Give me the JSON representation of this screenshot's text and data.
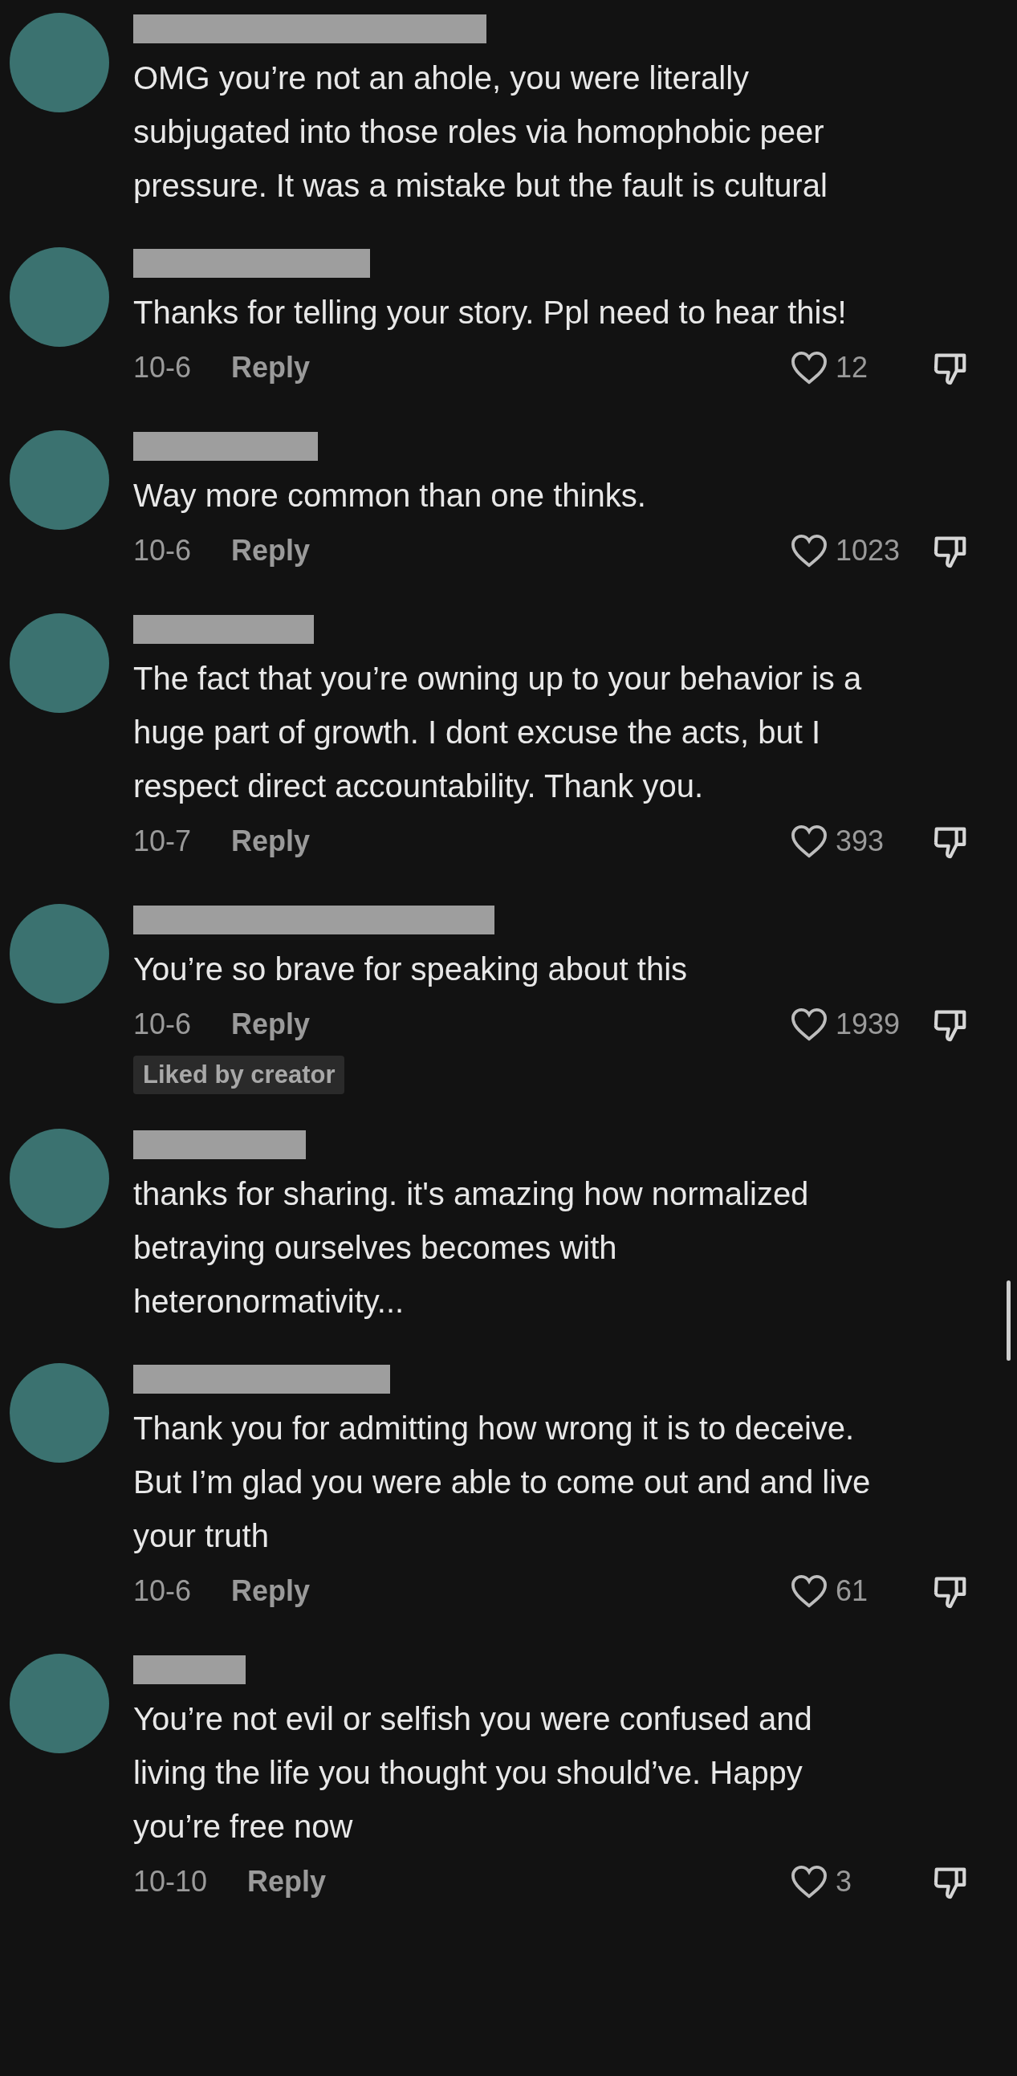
{
  "comments": [
    {
      "text": "OMG you’re not an ahole, you were literally subjugated into those roles via homophobic peer pressure. It was a mistake but the fault is cultural"
    },
    {
      "text": "Thanks for telling your story. Ppl need to hear this!",
      "date": "10-6",
      "reply_label": "Reply",
      "likes": "12"
    },
    {
      "text": "Way more common than one thinks.",
      "date": "10-6",
      "reply_label": "Reply",
      "likes": "1023"
    },
    {
      "text": "The fact that you’re owning up to your behavior is a huge part of growth. I dont excuse the acts, but I respect direct accountability. Thank you.",
      "date": "10-7",
      "reply_label": "Reply",
      "likes": "393"
    },
    {
      "text": "You’re so brave for speaking about this",
      "date": "10-6",
      "reply_label": "Reply",
      "likes": "1939",
      "liked_label": "Liked by creator"
    },
    {
      "text": "thanks for sharing. it's amazing how normalized betraying ourselves becomes with heteronormativity..."
    },
    {
      "text": "Thank you for admitting how wrong it is to deceive. But I’m glad you were able to come out and and live your truth",
      "date": "10-6",
      "reply_label": "Reply",
      "likes": "61"
    },
    {
      "text": "You’re not evil or selfish you were confused and living the life you thought you should’ve. Happy you’re free now",
      "date": "10-10",
      "reply_label": "Reply",
      "likes": "3"
    }
  ]
}
